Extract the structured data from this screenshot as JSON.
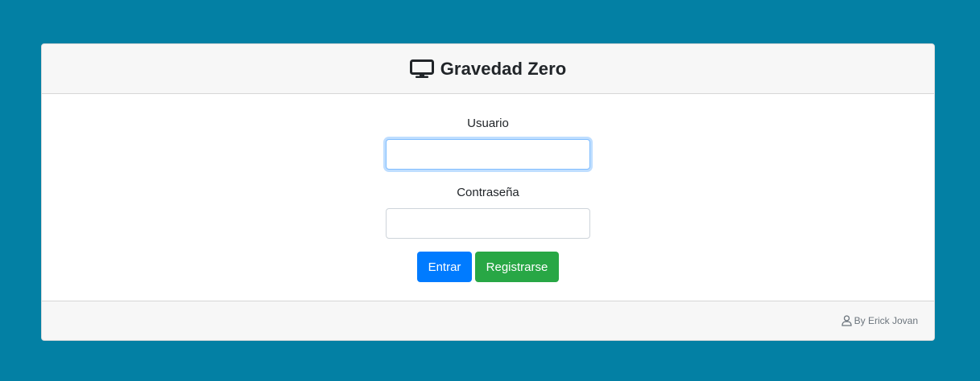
{
  "header": {
    "icon": "monitor-icon",
    "title": "Gravedad Zero"
  },
  "form": {
    "username_label": "Usuario",
    "username_value": "",
    "password_label": "Contraseña",
    "password_value": ""
  },
  "buttons": {
    "login_label": "Entrar",
    "register_label": "Registrarse"
  },
  "footer": {
    "icon": "user-icon",
    "credit": "By Erick Jovan"
  },
  "colors": {
    "background": "#0380a4",
    "primary": "#007bff",
    "success": "#28a745"
  }
}
